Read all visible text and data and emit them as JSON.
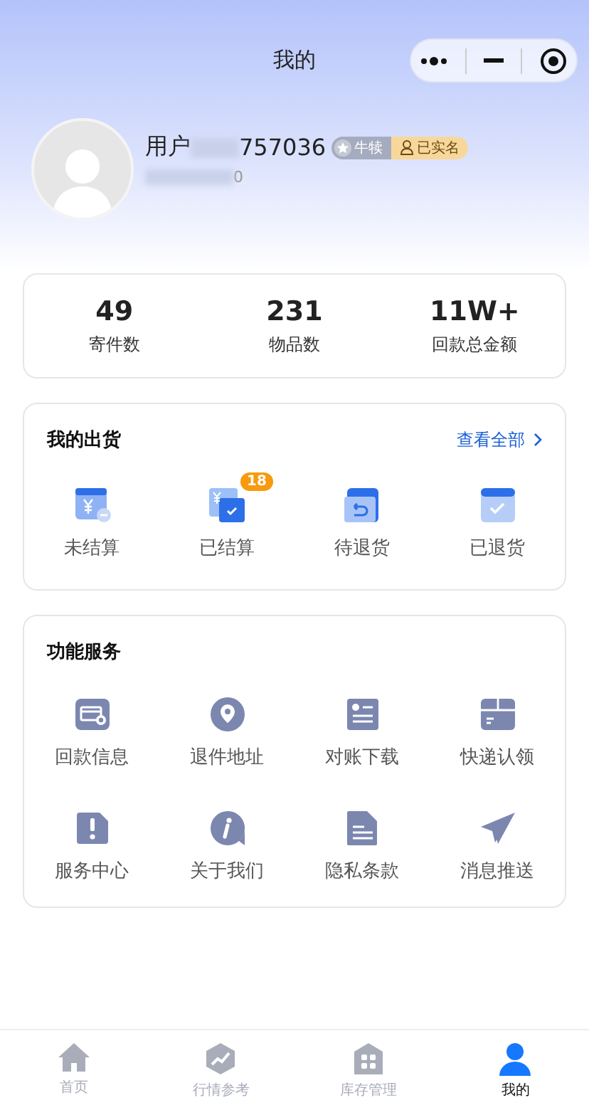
{
  "nav_bar": {
    "title": "我的"
  },
  "profile": {
    "name_prefix": "用户",
    "name_suffix": "757036",
    "phone_tail": "0",
    "badges": [
      {
        "kind": "level",
        "label": "牛犊"
      },
      {
        "kind": "verified",
        "label": "已实名"
      }
    ]
  },
  "stats": [
    {
      "value": "49",
      "label": "寄件数"
    },
    {
      "value": "231",
      "label": "物品数"
    },
    {
      "value": "11W+",
      "label": "回款总金额"
    }
  ],
  "shipments": {
    "title": "我的出货",
    "view_all": "查看全部",
    "items": [
      {
        "kind": "unsettled",
        "label": "未结算"
      },
      {
        "kind": "settled",
        "label": "已结算",
        "badge": "18"
      },
      {
        "kind": "pending-return",
        "label": "待退货"
      },
      {
        "kind": "returned",
        "label": "已退货"
      }
    ]
  },
  "services": {
    "title": "功能服务",
    "items": [
      {
        "kind": "card",
        "label": "回款信息"
      },
      {
        "kind": "pin",
        "label": "退件地址"
      },
      {
        "kind": "form",
        "label": "对账下载"
      },
      {
        "kind": "box",
        "label": "快递认领"
      },
      {
        "kind": "alert",
        "label": "服务中心"
      },
      {
        "kind": "info",
        "label": "关于我们"
      },
      {
        "kind": "doc",
        "label": "隐私条款"
      },
      {
        "kind": "plane",
        "label": "消息推送"
      }
    ]
  },
  "tab_bar": [
    {
      "kind": "home",
      "label": "首页",
      "selected": false
    },
    {
      "kind": "chart",
      "label": "行情参考",
      "selected": false
    },
    {
      "kind": "store",
      "label": "库存管理",
      "selected": false
    },
    {
      "kind": "user",
      "label": "我的",
      "selected": true
    }
  ]
}
